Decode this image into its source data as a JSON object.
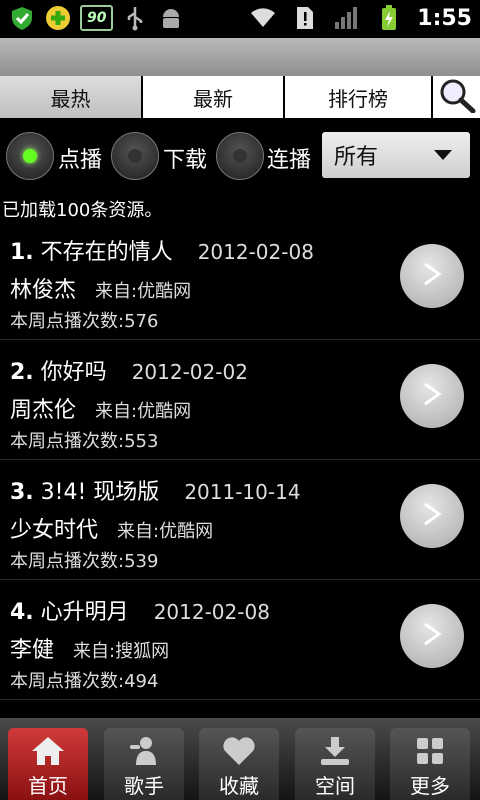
{
  "status_bar": {
    "battery": "90",
    "time": "1:55"
  },
  "tabs": [
    {
      "label": "最热",
      "active": true
    },
    {
      "label": "最新",
      "active": false
    },
    {
      "label": "排行榜",
      "active": false
    }
  ],
  "filters": {
    "options": [
      {
        "label": "点播",
        "selected": true
      },
      {
        "label": "下载",
        "selected": false
      },
      {
        "label": "连播",
        "selected": false
      }
    ],
    "dropdown_value": "所有"
  },
  "loaded_text": "已加载100条资源。",
  "items": [
    {
      "num": "1.",
      "title": "不存在的情人",
      "date": "2012-02-08",
      "artist": "林俊杰",
      "source": "来自:优酷网",
      "plays": "本周点播次数:576"
    },
    {
      "num": "2.",
      "title": "你好吗",
      "date": "2012-02-02",
      "artist": "周杰伦",
      "source": "来自:优酷网",
      "plays": "本周点播次数:553"
    },
    {
      "num": "3.",
      "title": "3!4! 现场版",
      "date": "2011-10-14",
      "artist": "少女时代",
      "source": "来自:优酷网",
      "plays": "本周点播次数:539"
    },
    {
      "num": "4.",
      "title": "心升明月",
      "date": "2012-02-08",
      "artist": "李健",
      "source": "来自:搜狐网",
      "plays": "本周点播次数:494"
    }
  ],
  "nav": [
    {
      "label": "首页",
      "icon": "home-icon",
      "active": true
    },
    {
      "label": "歌手",
      "icon": "singer-icon",
      "active": false
    },
    {
      "label": "收藏",
      "icon": "heart-icon",
      "active": false
    },
    {
      "label": "空间",
      "icon": "download-icon",
      "active": false
    },
    {
      "label": "更多",
      "icon": "grid-icon",
      "active": false
    }
  ]
}
